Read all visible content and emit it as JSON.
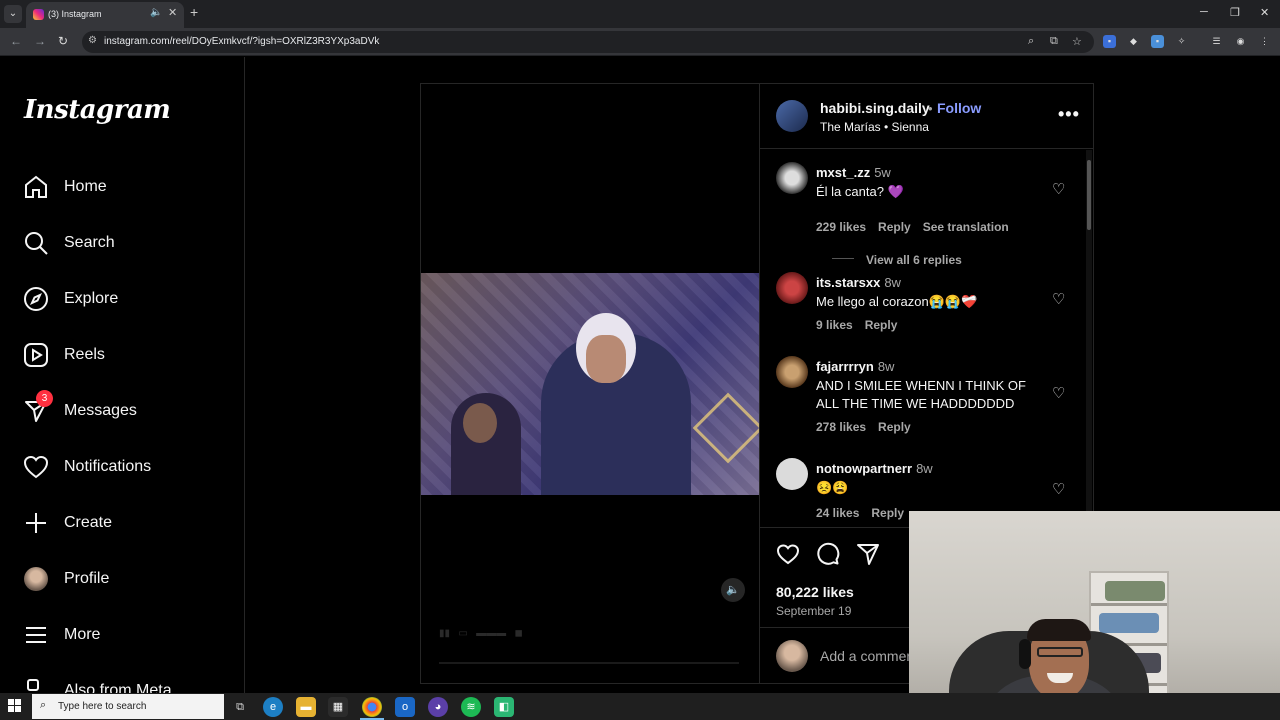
{
  "browser": {
    "tab_title": "(3) Instagram",
    "url": "instagram.com/reel/DOyExmkvcf/?igsh=OXRlZ3R3YXp3aDVk",
    "tab_menu_icon": "chevron-down-icon",
    "new_tab_icon": "plus-icon"
  },
  "sidebar": {
    "logo": "Instagram",
    "items": [
      {
        "label": "Home"
      },
      {
        "label": "Search"
      },
      {
        "label": "Explore"
      },
      {
        "label": "Reels"
      },
      {
        "label": "Messages",
        "badge": "3"
      },
      {
        "label": "Notifications"
      },
      {
        "label": "Create"
      },
      {
        "label": "Profile"
      },
      {
        "label": "More"
      },
      {
        "label": "Also from Meta"
      }
    ]
  },
  "post": {
    "username": "habibi.sing.daily",
    "dot": "•",
    "follow_label": "Follow",
    "audio": "The Marías • Sienna",
    "more_icon": "•••",
    "likes": "80,222 likes",
    "date": "September 19",
    "add_comment_placeholder": "Add a comment...",
    "comments": [
      {
        "user": "mxst_.zz",
        "time": "5w",
        "text": "Él la canta? 💜",
        "likes": "229 likes",
        "reply": "Reply",
        "translate": "See translation",
        "view_replies": "View all 6 replies"
      },
      {
        "user": "its.starsxx",
        "time": "8w",
        "text": "Me llego al corazon😭😭❤️‍🩹",
        "likes": "9 likes",
        "reply": "Reply"
      },
      {
        "user": "fajarrrryn",
        "time": "8w",
        "text": "AND I SMILEE WHENN I THINK OF ALL THE TIME WE HADDDDDDD",
        "likes": "278 likes",
        "reply": "Reply"
      },
      {
        "user": "notnowpartnerr",
        "time": "8w",
        "text": "😣😩",
        "likes": "24 likes",
        "reply": "Reply"
      }
    ]
  },
  "taskbar": {
    "search_placeholder": "Type here to search"
  },
  "colors": {
    "follow": "#8a9cff",
    "badge": "#ff3040",
    "background": "#000000"
  }
}
